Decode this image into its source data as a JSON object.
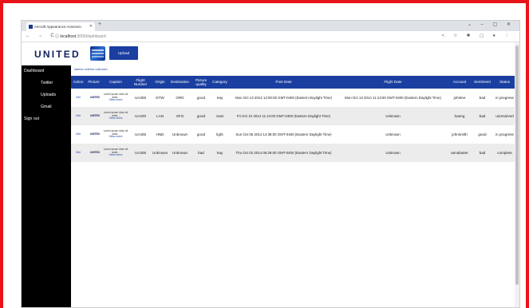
{
  "browser": {
    "tab_title": "Aircraft Appearance Assessm",
    "tab_close": "✕",
    "new_tab": "+",
    "window_controls": "⌄ – ▢ ✕",
    "nav": "← → C",
    "url_host": "localhost",
    "url_path": ":3000/dashboard",
    "extension_icons": "< ☆ ✱ ▢ ● ⋮"
  },
  "header": {
    "logo": "UNITED",
    "upload_label": "Upload"
  },
  "sidebar": {
    "items": [
      {
        "label": "Dashboard",
        "level": 0
      },
      {
        "label": "Twitter",
        "level": 1
      },
      {
        "label": "Uploads",
        "level": 1
      },
      {
        "label": "Gmail",
        "level": 1
      },
      {
        "label": "Sign out",
        "level": 0
      }
    ]
  },
  "filter_text": "interior exterior unknown",
  "table": {
    "columns": [
      "Action",
      "Picture",
      "Caption",
      "Flight Number",
      "Origin",
      "Destination",
      "Picture quality",
      "Category",
      "Post Date",
      "Flight Date",
      "Account",
      "Sentiment",
      "Status"
    ],
    "rows": [
      {
        "action": "Edit",
        "picture_logo": "UNITED",
        "caption": "Lorem ipsum dolor sit amet...",
        "view_more": "View more",
        "flight_number": "UA306",
        "origin": "DTW",
        "destination": "ORD",
        "quality": "good",
        "category": "tray",
        "post_date": "Mon Oct 13 2014 12:00:00 GMT-0400 (Eastern Daylight Time)",
        "flight_date": "Mon Oct 13 2014 11:13:00 GMT-0400 (Eastern Daylight Time)",
        "account": "johnlee",
        "sentiment": "bad",
        "status": "in progress"
      },
      {
        "action": "Edit",
        "picture_logo": "UNITED",
        "caption": "Lorem ipsum dolor sit amet...",
        "view_more": "View more",
        "flight_number": "UA200",
        "origin": "LAN",
        "destination": "SFO",
        "quality": "good",
        "category": "seat",
        "post_date": "Fri Oct 10 2014 11:13:00 GMT-0400 (Eastern Daylight Time)",
        "flight_date": "Unknown",
        "account": "haeng",
        "sentiment": "bad",
        "status": "unresolved"
      },
      {
        "action": "Edit",
        "picture_logo": "UNITED",
        "caption": "Lorem ipsum dolor sit amet...",
        "view_more": "View more",
        "flight_number": "UA405",
        "origin": "HND",
        "destination": "Unknown",
        "quality": "good",
        "category": "light",
        "post_date": "Sun Oct 05 2014 14:38:00 GMT-0400 (Eastern Daylight Time)",
        "flight_date": "Unknown",
        "account": "johnsmith",
        "sentiment": "good",
        "status": "in progress"
      },
      {
        "action": "Edit",
        "picture_logo": "UNITED",
        "caption": "Lorem ipsum dolor sit amet...",
        "view_more": "View more",
        "flight_number": "UA306",
        "origin": "Unknown",
        "destination": "Unknown",
        "quality": "bad",
        "category": "tray",
        "post_date": "Thu Oct 02 2014 06:29:00 GMT-0400 (Eastern Daylight Time)",
        "flight_date": "Unknown",
        "account": "annabaker",
        "sentiment": "bad",
        "status": "complete"
      }
    ]
  },
  "colors": {
    "frame": "#e8141a",
    "brand": "#1a3fa0",
    "sidebar": "#000000"
  }
}
